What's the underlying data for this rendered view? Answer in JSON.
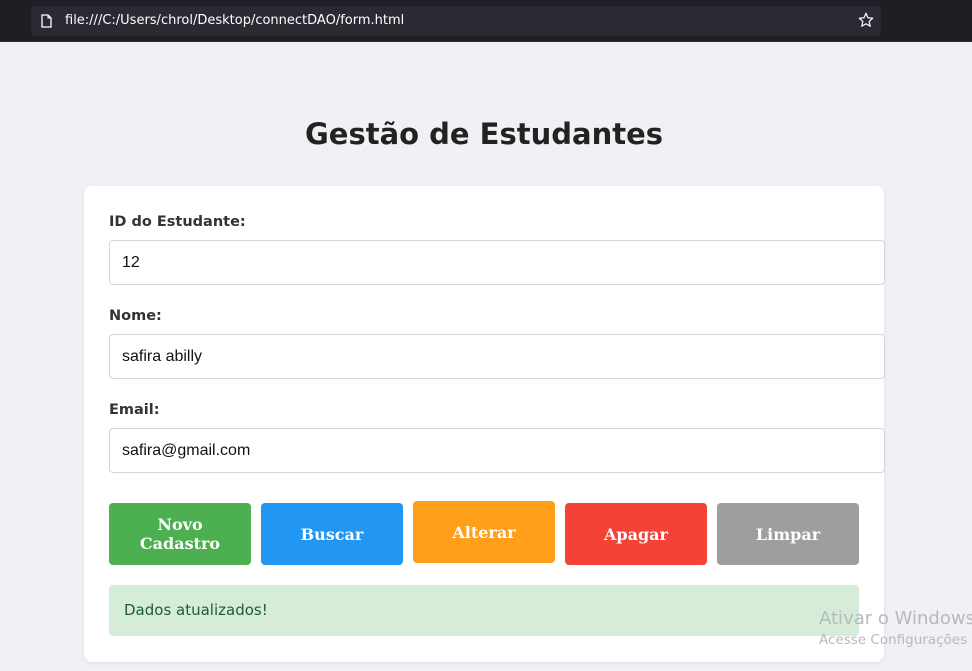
{
  "browser": {
    "url": "file:///C:/Users/chrol/Desktop/connectDAO/form.html",
    "page_icon": "page-icon",
    "bookmark_icon": "star-icon"
  },
  "page": {
    "title": "Gestão de Estudantes"
  },
  "form": {
    "id_label": "ID do Estudante:",
    "id_value": "12",
    "name_label": "Nome:",
    "name_value": "safira abilly",
    "email_label": "Email:",
    "email_value": "safira@gmail.com"
  },
  "buttons": {
    "new": "Novo Cadastro",
    "search": "Buscar",
    "update": "Alterar",
    "delete": "Apagar",
    "clear": "Limpar"
  },
  "colors": {
    "new": "#4caf50",
    "search": "#2196f3",
    "update": "#ff9f1a",
    "delete": "#f44336",
    "clear": "#9e9e9e",
    "success_bg": "#d5ecd9"
  },
  "status": {
    "message": "Dados atualizados!"
  },
  "watermark": {
    "line1": "Ativar o Windows",
    "line2": "Acesse Configurações p"
  }
}
